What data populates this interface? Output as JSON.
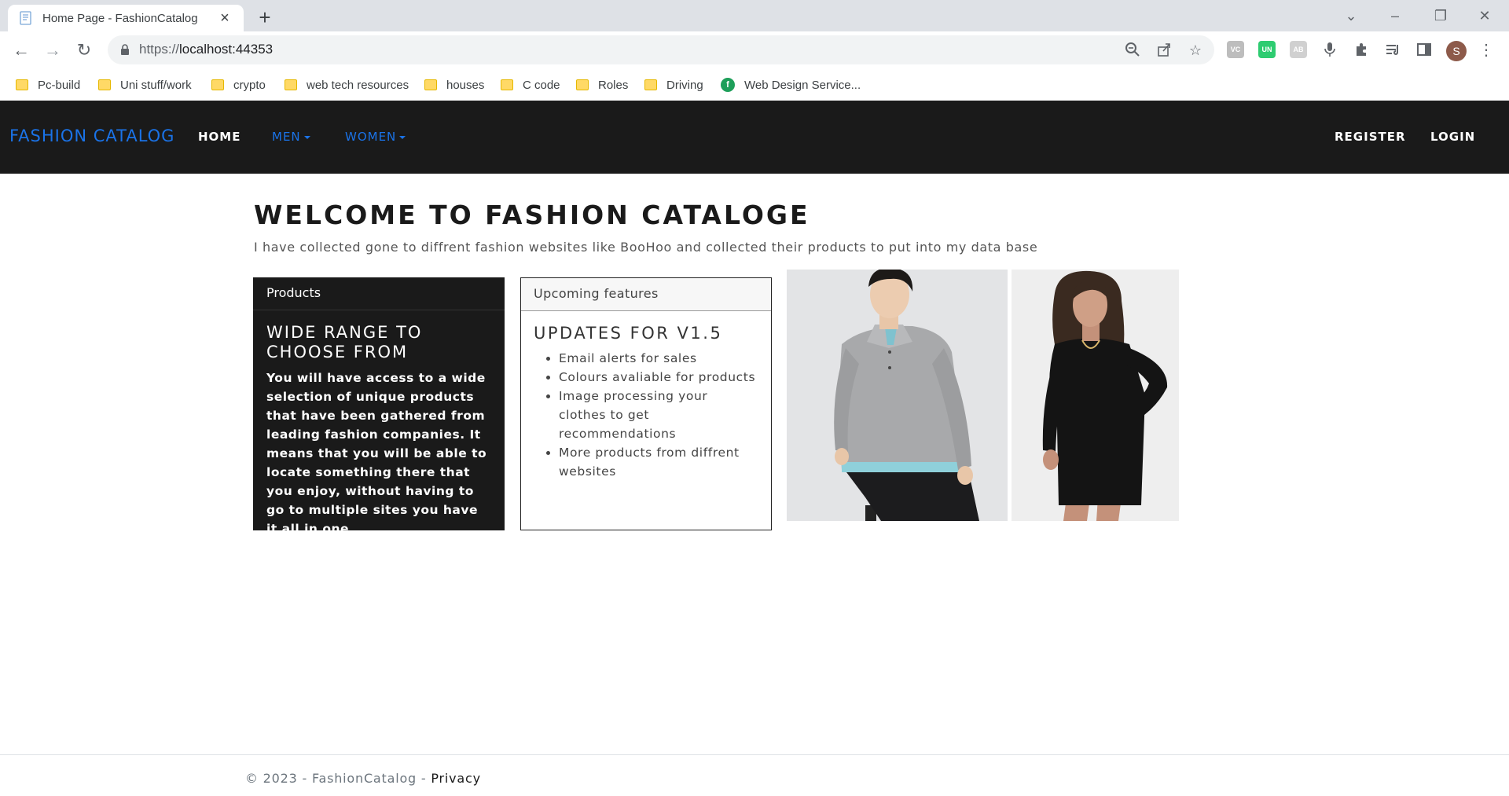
{
  "browser": {
    "tab_title": "Home Page - FashionCatalog",
    "new_tab": "+",
    "url_scheme": "https://",
    "url_host": "localhost:44353",
    "profile_initial": "S",
    "extensions": [
      "VC",
      "UN",
      "AB"
    ],
    "bookmarks": [
      {
        "label": "Pc-build",
        "icon": "folder-icon"
      },
      {
        "label": "Uni stuff/work",
        "icon": "folder-icon"
      },
      {
        "label": "crypto",
        "icon": "folder-icon"
      },
      {
        "label": "web tech resources",
        "icon": "folder-icon"
      },
      {
        "label": "houses",
        "icon": "folder-icon"
      },
      {
        "label": "C code",
        "icon": "folder-icon"
      },
      {
        "label": "Roles",
        "icon": "folder-icon"
      },
      {
        "label": "Driving",
        "icon": "folder-icon"
      },
      {
        "label": "Web Design Service...",
        "icon": "site-icon"
      }
    ]
  },
  "site": {
    "brand": "FASHION CATALOG",
    "nav": {
      "home": "HOME",
      "men": "MEN",
      "women": "WOMEN",
      "register": "REGISTER",
      "login": "LOGIN"
    },
    "accent_color": "#1a73e8",
    "nav_bg": "#1a1a1a"
  },
  "main": {
    "title": "WELCOME TO FASHION CATALOGE",
    "lead": "I have collected gone to diffrent fashion websites like BooHoo and collected their products to put into my data base",
    "products_card": {
      "header": "Products",
      "title": "WIDE RANGE TO CHOOSE FROM",
      "text": "You will have access to a wide selection of unique products that have been gathered from leading fashion companies. It means that you will be able to locate something there that you enjoy, without having to go to multiple sites you have it all in one."
    },
    "features_card": {
      "header": "Upcoming features",
      "title": "UPDATES FOR V1.5",
      "items": [
        "Email alerts for sales",
        "Colours avaliable for products",
        "Image processing your clothes to get recommendations",
        "More products from diffrent websites"
      ]
    },
    "images": {
      "men": "men-model-photo",
      "women": "women-model-photo"
    }
  },
  "footer": {
    "copyright": "© 2023 - FashionCatalog - ",
    "privacy": "Privacy"
  }
}
